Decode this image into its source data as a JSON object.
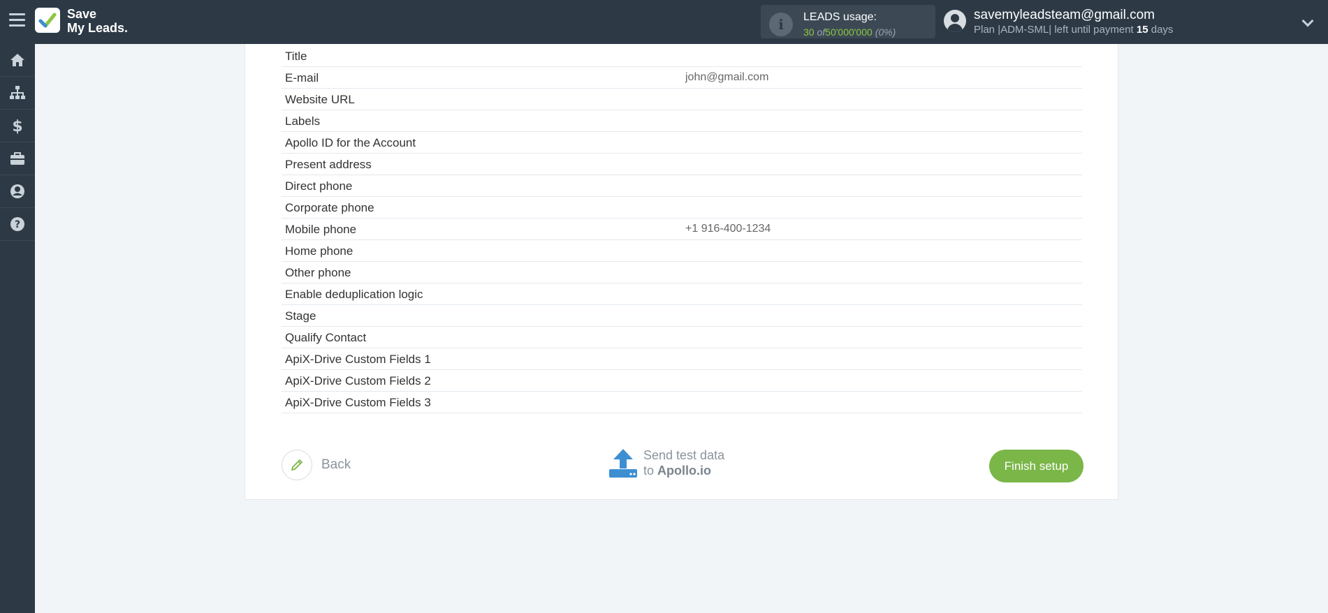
{
  "header": {
    "logo_line1": "Save",
    "logo_line2": "My Leads.",
    "usage_title": "LEADS usage:",
    "usage_used": "30",
    "usage_of": "of",
    "usage_total": "50'000'000",
    "usage_percent": "(0%)",
    "account_email": "savemyleadsteam@gmail.com",
    "plan_prefix": "Plan |ADM-SML| left until payment",
    "plan_days": "15",
    "plan_suffix": "days"
  },
  "sidebar": {
    "items": [
      {
        "icon": "home-icon"
      },
      {
        "icon": "sitemap-icon"
      },
      {
        "icon": "dollar-icon"
      },
      {
        "icon": "briefcase-icon"
      },
      {
        "icon": "user-icon"
      },
      {
        "icon": "help-icon"
      }
    ]
  },
  "fields": [
    {
      "label": "Title",
      "value": ""
    },
    {
      "label": "E-mail",
      "value": "john@gmail.com"
    },
    {
      "label": "Website URL",
      "value": ""
    },
    {
      "label": "Labels",
      "value": ""
    },
    {
      "label": "Apollo ID for the Account",
      "value": ""
    },
    {
      "label": "Present address",
      "value": ""
    },
    {
      "label": "Direct phone",
      "value": ""
    },
    {
      "label": "Corporate phone",
      "value": ""
    },
    {
      "label": "Mobile phone",
      "value": "+1 916-400-1234"
    },
    {
      "label": "Home phone",
      "value": ""
    },
    {
      "label": "Other phone",
      "value": ""
    },
    {
      "label": "Enable deduplication logic",
      "value": ""
    },
    {
      "label": "Stage",
      "value": ""
    },
    {
      "label": "Qualify Contact",
      "value": ""
    },
    {
      "label": "ApiX-Drive Custom Fields 1",
      "value": ""
    },
    {
      "label": "ApiX-Drive Custom Fields 2",
      "value": ""
    },
    {
      "label": "ApiX-Drive Custom Fields 3",
      "value": ""
    }
  ],
  "actions": {
    "back_label": "Back",
    "send_line1": "Send test data",
    "send_to": "to",
    "send_target": "Apollo.io",
    "finish_label": "Finish setup"
  },
  "colors": {
    "topbar": "#2d3a46",
    "accent_green": "#7ab648",
    "send_icon_blue": "#3d8fd1"
  }
}
